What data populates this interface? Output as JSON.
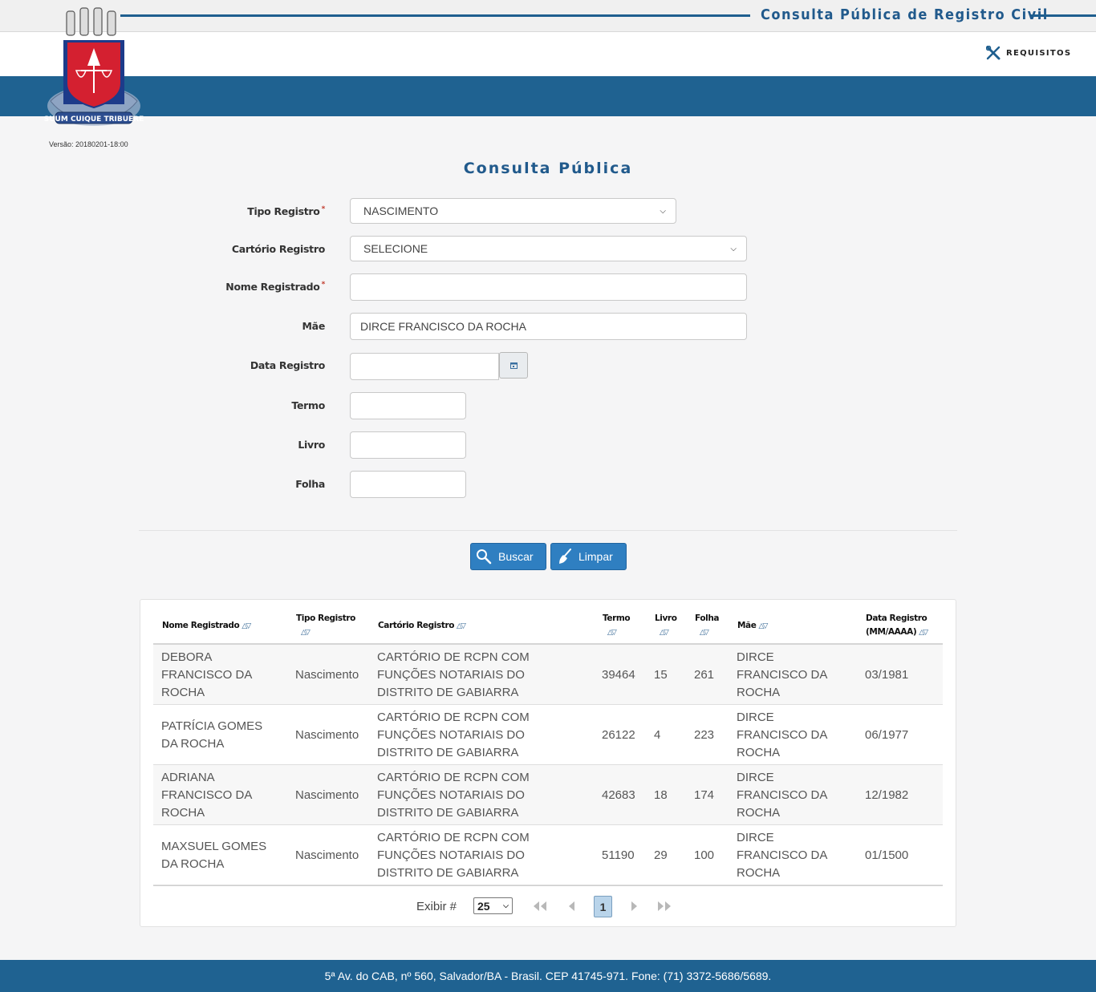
{
  "header": {
    "title": "Consulta Pública de Registro Civil",
    "requirements_label": "REQUISITOS",
    "version": "Versão: 20180201-18:00",
    "brand_color": "#1f6291"
  },
  "form": {
    "title": "Consulta Pública",
    "tipo_registro": {
      "label": "Tipo Registro",
      "value": "NASCIMENTO",
      "required": true
    },
    "cartorio_registro": {
      "label": "Cartório Registro",
      "value": "SELECIONE"
    },
    "nome_registrado": {
      "label": "Nome Registrado",
      "value": "",
      "required": true
    },
    "mae": {
      "label": "Mãe",
      "value": "DIRCE FRANCISCO DA ROCHA"
    },
    "data_registro": {
      "label": "Data Registro",
      "value": ""
    },
    "termo": {
      "label": "Termo",
      "value": ""
    },
    "livro": {
      "label": "Livro",
      "value": ""
    },
    "folha": {
      "label": "Folha",
      "value": ""
    },
    "required_mark": "*",
    "search_button": "Buscar",
    "clear_button": "Limpar"
  },
  "table": {
    "columns": {
      "nome": "Nome Registrado",
      "tipo": "Tipo Registro",
      "cartorio": "Cartório Registro",
      "termo": "Termo",
      "livro": "Livro",
      "folha": "Folha",
      "mae": "Mãe",
      "data_line1": "Data Registro",
      "data_line2": "(MM/AAAA)"
    },
    "rows": [
      {
        "nome": "DEBORA FRANCISCO DA ROCHA",
        "tipo": "Nascimento",
        "cartorio": "CARTÓRIO DE RCPN COM FUNÇÕES NOTARIAIS DO DISTRITO DE GABIARRA",
        "termo": "39464",
        "livro": "15",
        "folha": "261",
        "mae": "DIRCE FRANCISCO DA ROCHA",
        "data": "03/1981"
      },
      {
        "nome": "PATRÍCIA GOMES DA ROCHA",
        "tipo": "Nascimento",
        "cartorio": "CARTÓRIO DE RCPN COM FUNÇÕES NOTARIAIS DO DISTRITO DE GABIARRA",
        "termo": "26122",
        "livro": "4",
        "folha": "223",
        "mae": "DIRCE FRANCISCO DA ROCHA",
        "data": "06/1977"
      },
      {
        "nome": "ADRIANA FRANCISCO DA ROCHA",
        "tipo": "Nascimento",
        "cartorio": "CARTÓRIO DE RCPN COM FUNÇÕES NOTARIAIS DO DISTRITO DE GABIARRA",
        "termo": "42683",
        "livro": "18",
        "folha": "174",
        "mae": "DIRCE FRANCISCO DA ROCHA",
        "data": "12/1982"
      },
      {
        "nome": "MAXSUEL GOMES DA ROCHA",
        "tipo": "Nascimento",
        "cartorio": "CARTÓRIO DE RCPN COM FUNÇÕES NOTARIAIS DO DISTRITO DE GABIARRA",
        "termo": "51190",
        "livro": "29",
        "folha": "100",
        "mae": "DIRCE FRANCISCO DA ROCHA",
        "data": "01/1500"
      }
    ],
    "pagination": {
      "label": "Exibir #",
      "page_size": "25",
      "current_page": "1"
    }
  },
  "footer": {
    "text": "5ª Av. do CAB, nº 560, Salvador/BA - Brasil. CEP 41745-971. Fone: (71) 3372-5686/5689."
  }
}
